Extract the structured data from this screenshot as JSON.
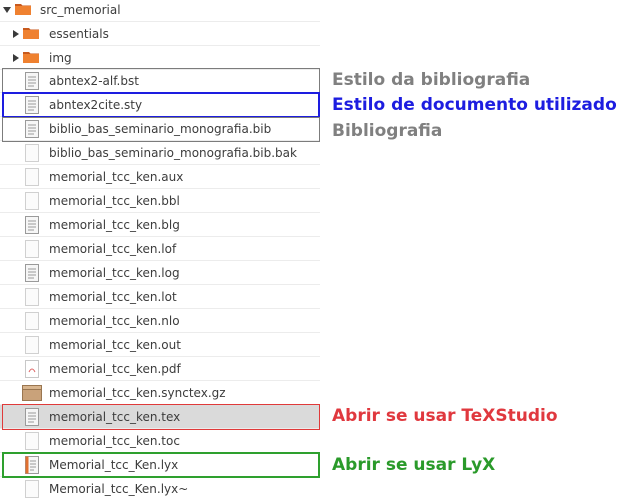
{
  "tree": {
    "root_folder": "src_memorial",
    "folders": [
      "essentials",
      "img"
    ],
    "files": [
      "abntex2-alf.bst",
      "abntex2cite.sty",
      "biblio_bas_seminario_monografia.bib",
      "biblio_bas_seminario_monografia.bib.bak",
      "memorial_tcc_ken.aux",
      "memorial_tcc_ken.bbl",
      "memorial_tcc_ken.blg",
      "memorial_tcc_ken.lof",
      "memorial_tcc_ken.log",
      "memorial_tcc_ken.lot",
      "memorial_tcc_ken.nlo",
      "memorial_tcc_ken.out",
      "memorial_tcc_ken.pdf",
      "memorial_tcc_ken.synctex.gz",
      "memorial_tcc_ken.tex",
      "memorial_tcc_ken.toc",
      "Memorial_tcc_Ken.lyx",
      "Memorial_tcc_Ken.lyx~"
    ],
    "selected_file": "memorial_tcc_ken.tex"
  },
  "annotations": {
    "bst": "Estilo da bibliografia",
    "sty": "Estilo de documento utilizado",
    "bib": "Bibliografia",
    "tex": "Abrir se usar TeXStudio",
    "lyx": "Abrir se usar LyX"
  },
  "colors": {
    "gray": "#808080",
    "blue": "#1d1de0",
    "red": "#e0383e",
    "green": "#2a9a2a",
    "folder_orange": "#e8732a",
    "selection": "#dadada"
  }
}
